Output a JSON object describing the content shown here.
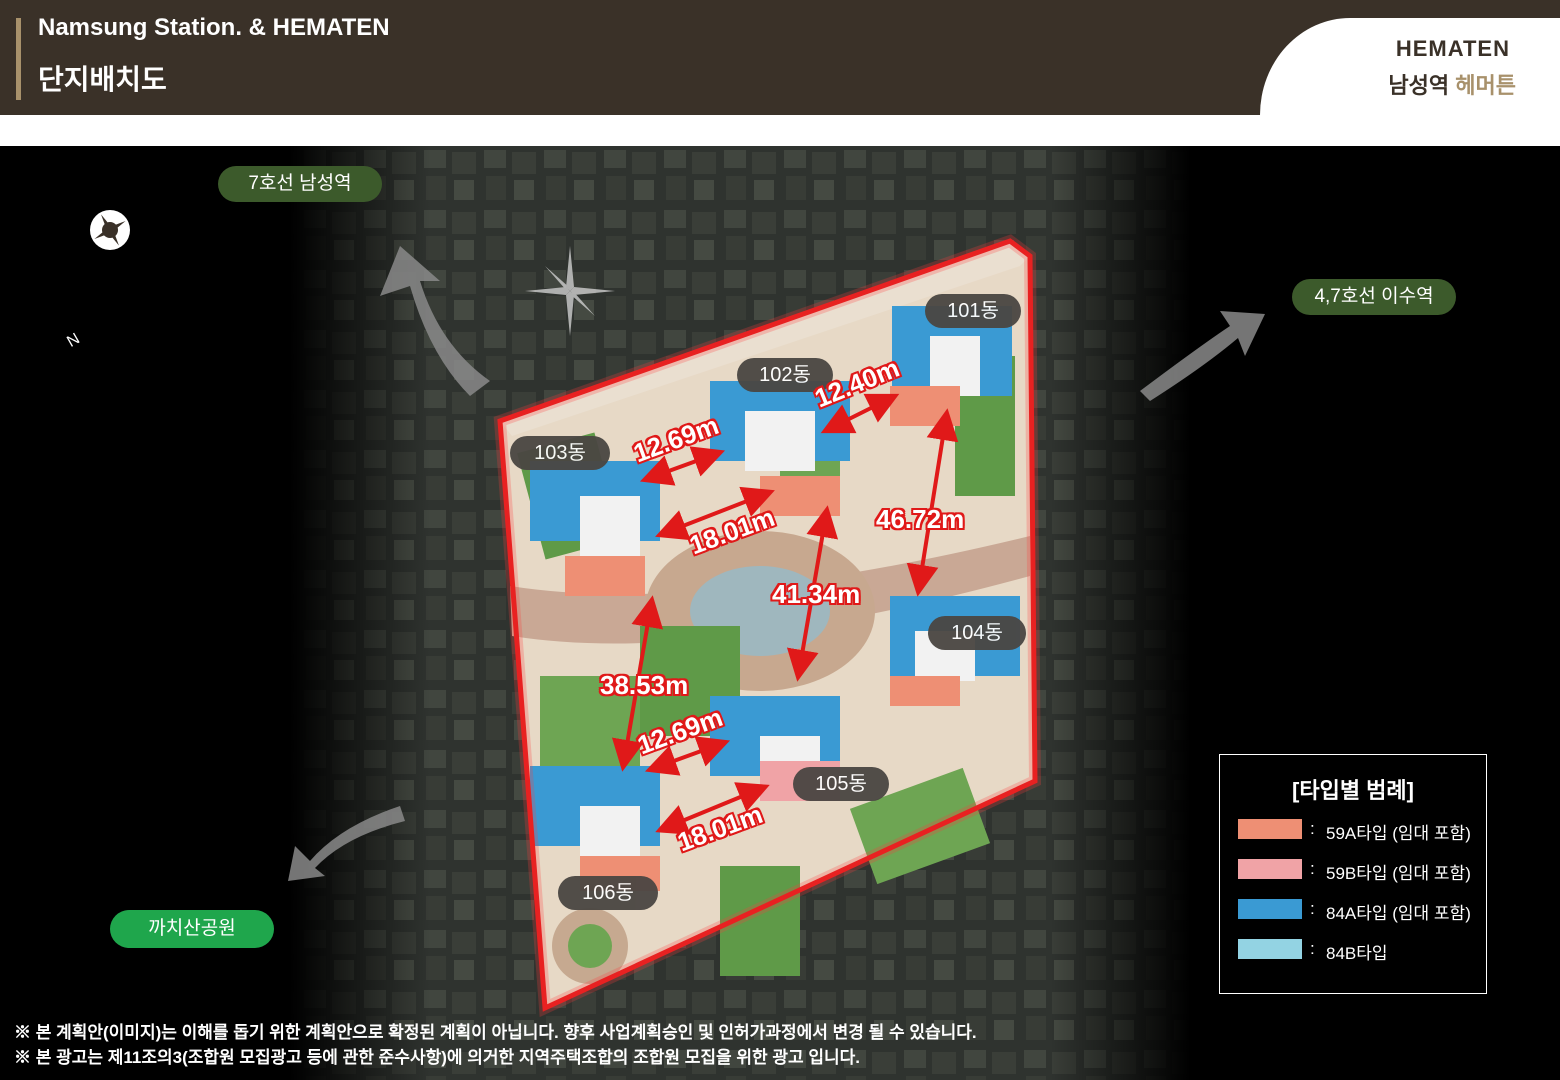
{
  "header": {
    "title_en": "Namsung Station. & HEMATEN",
    "title_ko": "단지배치도",
    "logo_en": "HEMATEN",
    "logo_ko_dark": "남성역",
    "logo_ko_gold": "헤머튼"
  },
  "map": {
    "compass_label": "N",
    "destinations": {
      "line7": "7호선 남성역",
      "line47": "4,7호선 이수역",
      "park": "까치산공원"
    },
    "buildings": [
      "101동",
      "102동",
      "103동",
      "104동",
      "105동",
      "106동"
    ],
    "distances": [
      "12.40m",
      "12.69m",
      "18.01m",
      "46.72m",
      "41.34m",
      "38.53m",
      "12.69m",
      "18.01m"
    ]
  },
  "legend": {
    "title": "[타입별 범례]",
    "items": [
      {
        "color": "#ee8f74",
        "label": "59A타입 (임대 포함)"
      },
      {
        "color": "#f0a3a6",
        "label": "59B타입 (임대 포함)"
      },
      {
        "color": "#3a9ad3",
        "label": "84A타입 (임대 포함)"
      },
      {
        "color": "#93d3e3",
        "label": "84B타입"
      }
    ]
  },
  "notes": [
    "※ 본 계획안(이미지)는 이해를 돕기 위한 계획안으로 확정된 계획이 아닙니다. 향후 사업계획승인 및 인허가과정에서 변경 될 수 있습니다.",
    "※ 본 광고는 제11조의3(조합원 모집광고 등에 관한 준수사항)에 의거한 지역주택조합의 조합원 모집을 위한 광고 입니다."
  ],
  "colors": {
    "header_bg": "#3a3128",
    "accent_gold": "#a8916b",
    "boundary_red": "#e01919"
  }
}
